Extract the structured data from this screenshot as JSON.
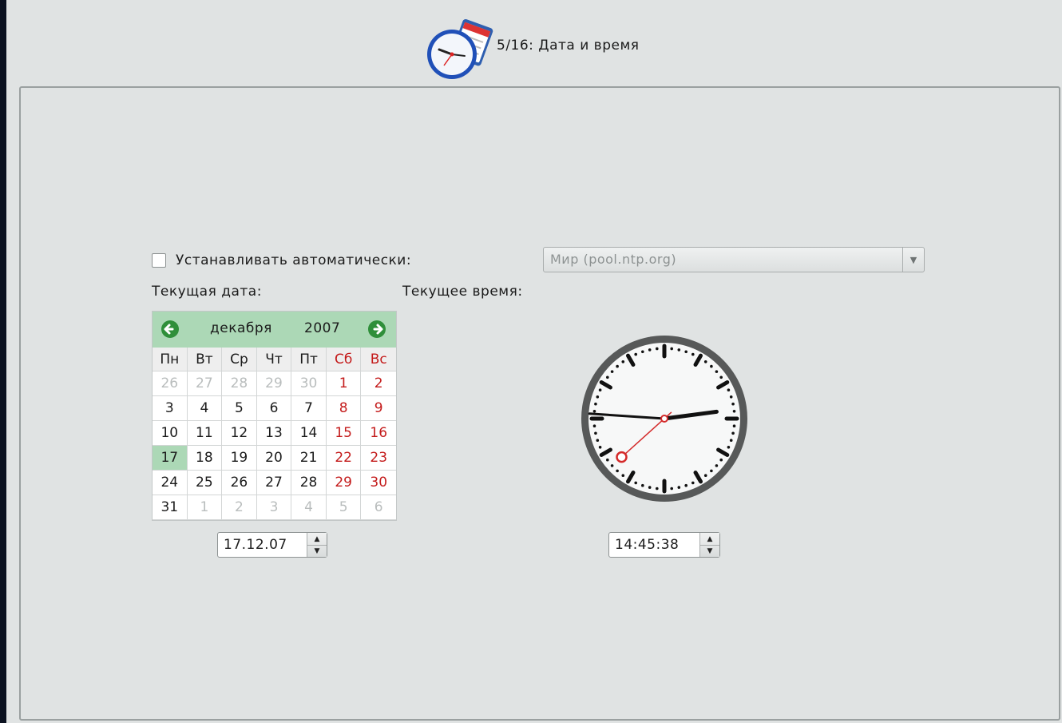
{
  "header": {
    "step_title": "5/16: Дата и время"
  },
  "auto": {
    "label": "Устанавливать автоматически:",
    "checked": false
  },
  "ntp": {
    "selected": "Мир (pool.ntp.org)"
  },
  "labels": {
    "current_date": "Текущая дата:",
    "current_time": "Текущее время:"
  },
  "calendar": {
    "month": "декабря",
    "year": "2007",
    "weekdays": [
      "Пн",
      "Вт",
      "Ср",
      "Чт",
      "Пт",
      "Сб",
      "Вс"
    ],
    "weeks": [
      [
        "26",
        "27",
        "28",
        "29",
        "30",
        "1",
        "2"
      ],
      [
        "3",
        "4",
        "5",
        "6",
        "7",
        "8",
        "9"
      ],
      [
        "10",
        "11",
        "12",
        "13",
        "14",
        "15",
        "16"
      ],
      [
        "17",
        "18",
        "19",
        "20",
        "21",
        "22",
        "23"
      ],
      [
        "24",
        "25",
        "26",
        "27",
        "28",
        "29",
        "30"
      ],
      [
        "31",
        "1",
        "2",
        "3",
        "4",
        "5",
        "6"
      ]
    ],
    "selected_day": "17"
  },
  "date_field": {
    "value": "17.12.07"
  },
  "time_field": {
    "value": "14:45:38"
  },
  "clock": {
    "hours": 14,
    "minutes": 45,
    "seconds": 38
  },
  "colors": {
    "weekend": "#c41c1c",
    "highlight": "#acd8b6",
    "hands": "#111111",
    "second_hand": "#d42a2a"
  },
  "icons": {
    "header": "clock-calendar-icon",
    "prev": "arrow-left-icon",
    "next": "arrow-right-icon",
    "dropdown": "chevron-down-icon",
    "spin_up": "triangle-up-icon",
    "spin_down": "triangle-down-icon"
  }
}
